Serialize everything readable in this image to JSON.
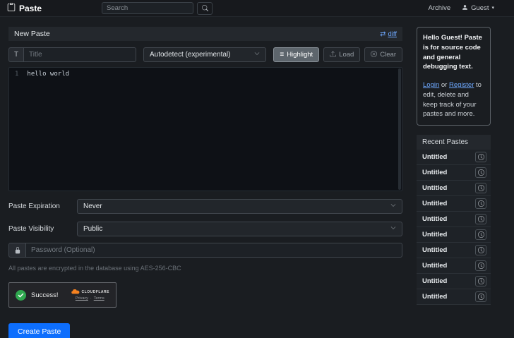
{
  "colors": {
    "accent": "#0d6efd",
    "link": "#6ea8fe",
    "success": "#2fa84f",
    "cloudflare_orange": "#f48120"
  },
  "icons": {
    "caret_down": "▾",
    "diff": "⇄",
    "menu": "≡",
    "bullet": "·"
  },
  "navbar": {
    "brand": "Paste",
    "search_placeholder": "Search",
    "archive_label": "Archive",
    "user_label": "Guest"
  },
  "panel": {
    "title": "New Paste",
    "diff_label": "diff"
  },
  "form": {
    "title_addon": "T",
    "title_placeholder": "Title",
    "language_value": "Autodetect (experimental)",
    "highlight_label": "Highlight",
    "load_label": "Load",
    "clear_label": "Clear"
  },
  "editor": {
    "line_number": "1",
    "code": "hello world"
  },
  "options": {
    "expiration_label": "Paste Expiration",
    "expiration_value": "Never",
    "visibility_label": "Paste Visibility",
    "visibility_value": "Public",
    "password_placeholder": "Password (Optional)",
    "encryption_note": "All pastes are encrypted in the database using AES-256-CBC"
  },
  "captcha": {
    "status": "Success!",
    "brand": "CLOUDFLARE",
    "privacy_label": "Privacy",
    "terms_label": "Terms"
  },
  "submit_label": "Create Paste",
  "sidebar": {
    "info_bold": "Hello Guest! Paste is for source code and general debugging text.",
    "login_label": "Login",
    "or_label": "or",
    "register_label": "Register",
    "info_rest": "to edit, delete and keep track of your pastes and more.",
    "recent_title": "Recent Pastes",
    "recent_items": [
      {
        "label": "Untitled"
      },
      {
        "label": "Untitled"
      },
      {
        "label": "Untitled"
      },
      {
        "label": "Untitled"
      },
      {
        "label": "Untitled"
      },
      {
        "label": "Untitled"
      },
      {
        "label": "Untitled"
      },
      {
        "label": "Untitled"
      },
      {
        "label": "Untitled"
      },
      {
        "label": "Untitled"
      }
    ]
  }
}
